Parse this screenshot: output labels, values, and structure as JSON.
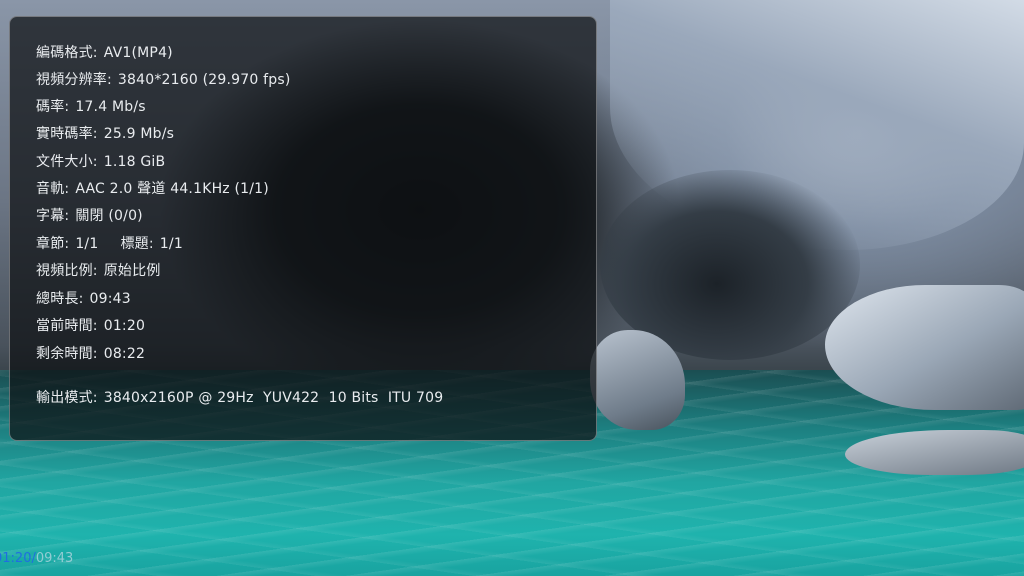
{
  "media_info": {
    "codec": {
      "label": "編碼格式:",
      "value": "AV1(MP4)"
    },
    "resolution": {
      "label": "視頻分辨率:",
      "value": "3840*2160 (29.970 fps)"
    },
    "bitrate": {
      "label": "碼率:",
      "value": "17.4 Mb/s"
    },
    "realtime_bitrate": {
      "label": "實時碼率:",
      "value": "25.9 Mb/s"
    },
    "file_size": {
      "label": "文件大小:",
      "value": "1.18 GiB"
    },
    "audio_track": {
      "label": "音軌:",
      "value": "AAC 2.0 聲道 44.1KHz (1/1)"
    },
    "subtitle": {
      "label": "字幕:",
      "value": "關閉 (0/0)"
    },
    "chapter": {
      "label": "章節:",
      "value": "1/1"
    },
    "title": {
      "label": "標題:",
      "value": "1/1"
    },
    "aspect_ratio": {
      "label": "視頻比例:",
      "value": "原始比例"
    },
    "total_duration": {
      "label": "總時長:",
      "value": "09:43"
    },
    "current_time": {
      "label": "當前時間:",
      "value": "01:20"
    },
    "remaining_time": {
      "label": "剩余時間:",
      "value": "08:22"
    },
    "output_mode": {
      "label": "輸出模式:",
      "value": "3840x2160P @ 29Hz  YUV422  10 Bits  ITU 709"
    }
  },
  "playback": {
    "current": "01:20",
    "separator": "/",
    "total": "09:43"
  },
  "colors": {
    "panel_bg": "#0e1013",
    "panel_text": "#e9ecef",
    "timecode_accent": "#1f6fe0"
  }
}
